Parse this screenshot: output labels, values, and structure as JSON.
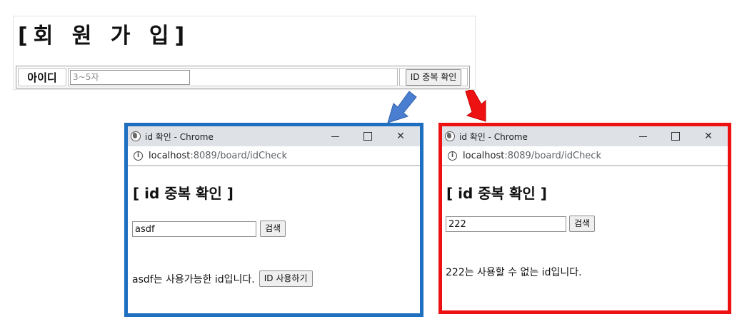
{
  "signup_form": {
    "title": "[회 원 가 입]",
    "id_label": "아이디",
    "id_placeholder": "3~5자",
    "check_button_label": "ID 중복 확인"
  },
  "popup_available": {
    "window_title": "id 확인 - Chrome",
    "url_host": "localhost",
    "url_path": ":8089/board/idCheck",
    "heading": "[ id 중복 확인 ]",
    "search_value": "asdf",
    "search_button_label": "검색",
    "result_message": "asdf는 사용가능한 id입니다.",
    "use_button_label": "ID 사용하기",
    "frame_color": "#1f6fc0"
  },
  "popup_unavailable": {
    "window_title": "id 확인 - Chrome",
    "url_host": "localhost",
    "url_path": ":8089/board/idCheck",
    "heading": "[ id 중복 확인 ]",
    "search_value": "222",
    "search_button_label": "검색",
    "result_message": "222는 사용할 수 없는 id입니다.",
    "frame_color": "#ee1111"
  },
  "icons": {
    "globe": "globe-icon",
    "info": "info-icon",
    "minimize": "minimize-icon",
    "maximize": "maximize-icon",
    "close": "close-icon",
    "arrow_blue": "arrow-down-left-icon",
    "arrow_red": "arrow-down-right-icon"
  },
  "colors": {
    "arrow_blue": "#4a7ed0",
    "arrow_red": "#ee1111"
  }
}
